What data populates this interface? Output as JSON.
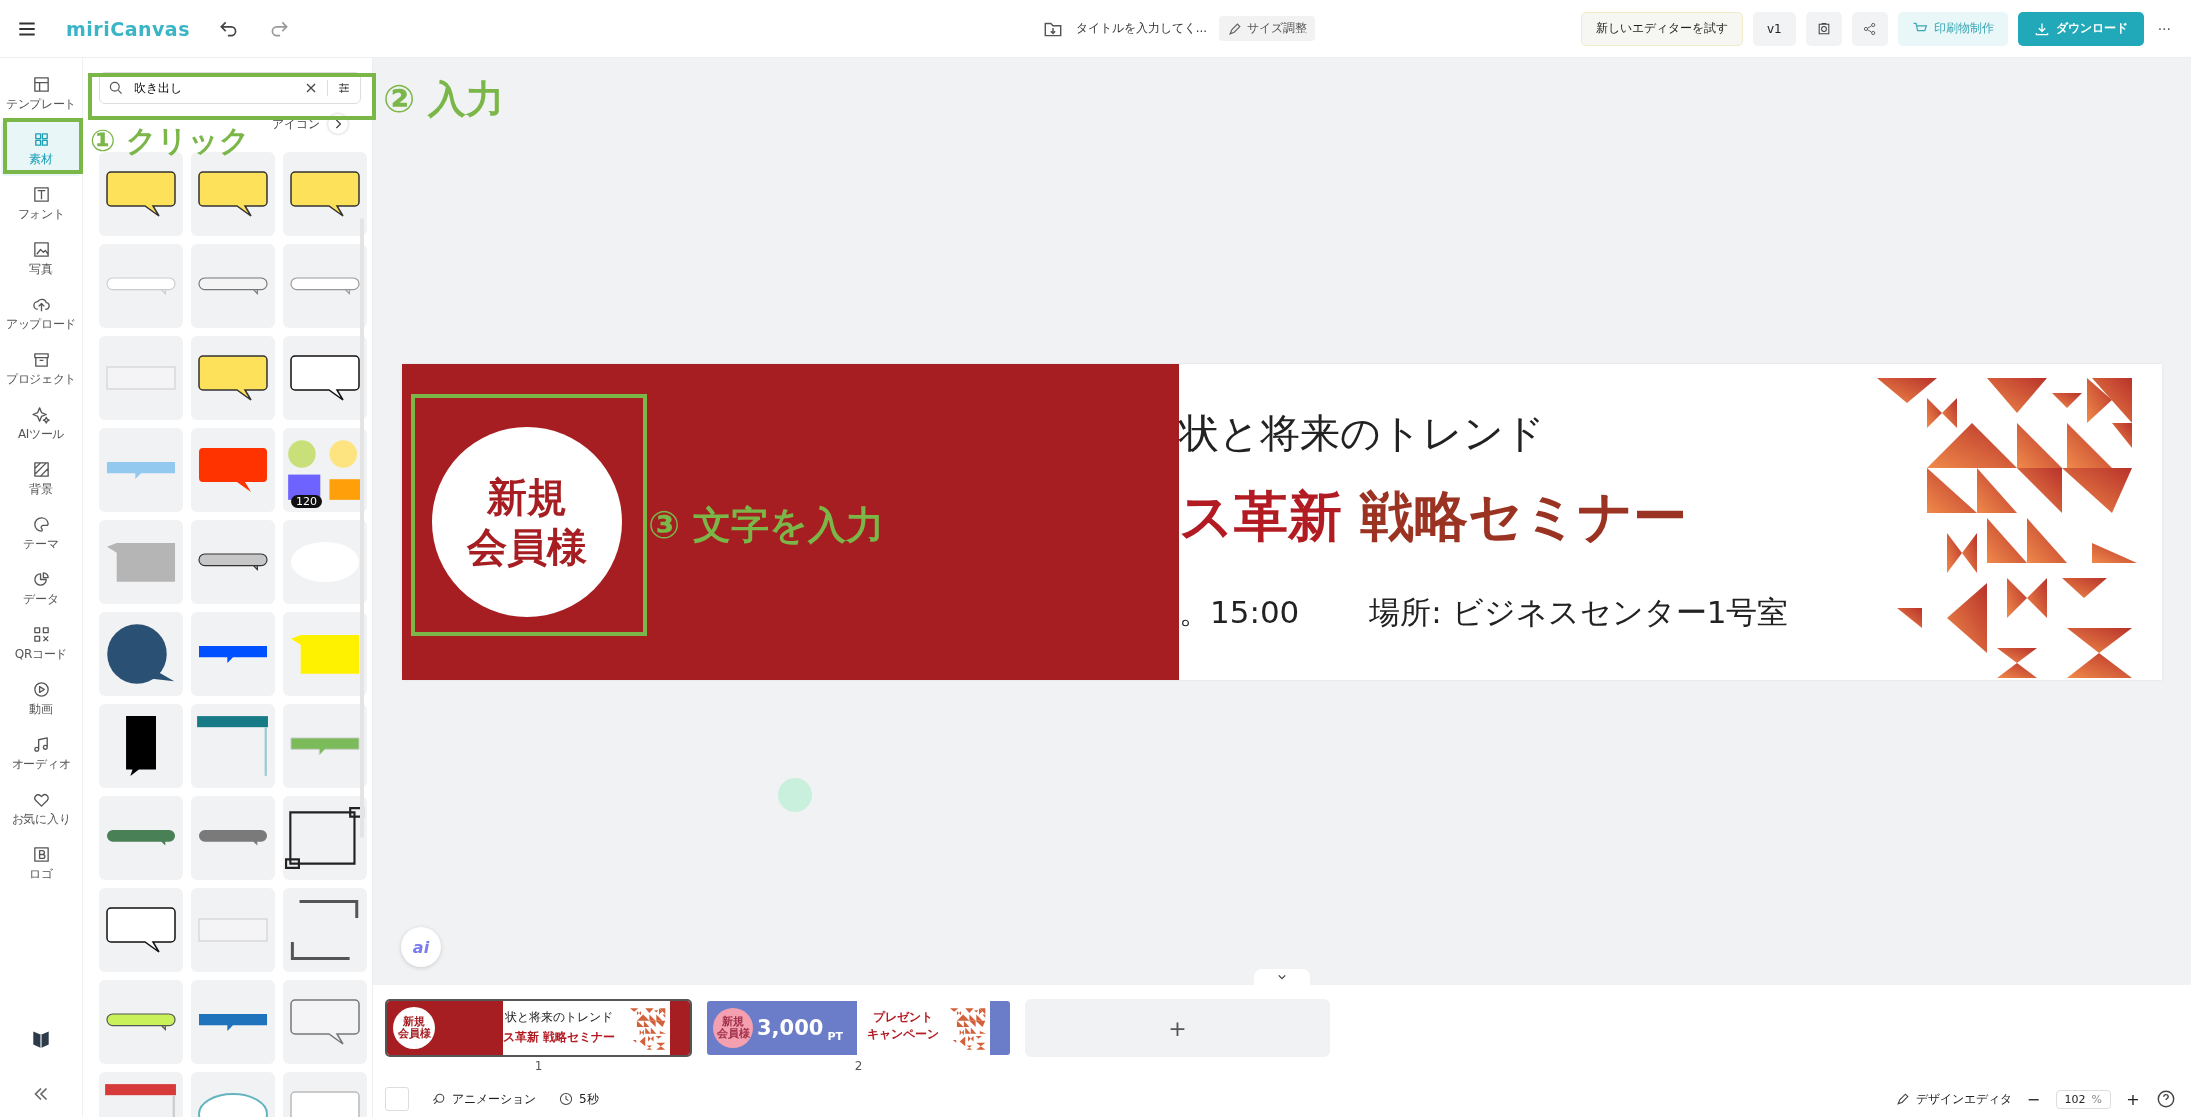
{
  "topbar": {
    "logo": "miriCanvas",
    "title": "タイトルを入力してく...",
    "resize": "サイズ調整",
    "try_new": "新しいエディターを試す",
    "version": "v1",
    "print": "印刷物制作",
    "download": "ダウンロード",
    "more": "···"
  },
  "rail": [
    {
      "label": "テンプレート",
      "selected": false
    },
    {
      "label": "素材",
      "selected": true
    },
    {
      "label": "フォント",
      "selected": false
    },
    {
      "label": "写真",
      "selected": false
    },
    {
      "label": "アップロード",
      "selected": false
    },
    {
      "label": "プロジェクト",
      "selected": false
    },
    {
      "label": "AIツール",
      "selected": false
    },
    {
      "label": "背景",
      "selected": false
    },
    {
      "label": "テーマ",
      "selected": false
    },
    {
      "label": "データ",
      "selected": false
    },
    {
      "label": "QRコード",
      "selected": false
    },
    {
      "label": "動画",
      "selected": false
    },
    {
      "label": "オーディオ",
      "selected": false
    },
    {
      "label": "お気に入り",
      "selected": false
    },
    {
      "label": "ロゴ",
      "selected": false
    }
  ],
  "panel": {
    "search": {
      "value": "吹き出し"
    },
    "tabs": [
      {
        "label": "アイコン",
        "selected": false
      }
    ],
    "badge": "120"
  },
  "design": {
    "badge": [
      "新規",
      "会員様"
    ],
    "subtitle": "状と将来のトレンド",
    "title_red": "ス革新",
    "title_dark": "戦略セミナー",
    "time": "。15:00",
    "place": "場所: ビジネスセンター1号室"
  },
  "pages": [
    {
      "number": "1",
      "selected": true,
      "kind": "seminar",
      "badge": [
        "新規",
        "会員様"
      ],
      "subtitle": "状と将来のトレンド",
      "title": "ス革新 戦略セミナー"
    },
    {
      "number": "2",
      "selected": false,
      "kind": "points",
      "badge": [
        "新規",
        "会員様"
      ],
      "amount": "3,000",
      "unit": "PT",
      "line1": "プレゼント",
      "line2": "キャンペーン"
    }
  ],
  "add_page": "+",
  "ai_button": "ai",
  "bottombar": {
    "animation": "アニメーション",
    "duration": "5秒",
    "design_editor": "デザインエディタ",
    "minus": "−",
    "zoom": "102",
    "percent": "%",
    "plus": "+"
  },
  "annotations": [
    {
      "label": "① クリック"
    },
    {
      "label": "② 入力"
    },
    {
      "label": "③ 文字を入力"
    }
  ]
}
